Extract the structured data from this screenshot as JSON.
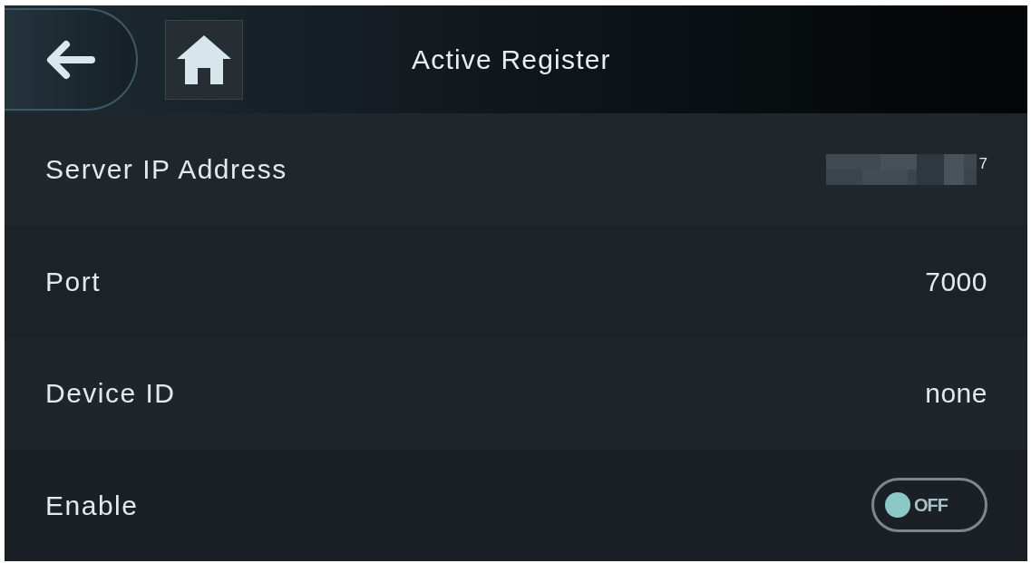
{
  "header": {
    "title": "Active Register"
  },
  "rows": [
    {
      "kind": "text",
      "label": "Server IP Address",
      "value": "7",
      "redacted": true
    },
    {
      "kind": "text",
      "label": "Port",
      "value": "7000",
      "redacted": false
    },
    {
      "kind": "text",
      "label": "Device ID",
      "value": "none",
      "redacted": false
    },
    {
      "kind": "toggle",
      "label": "Enable",
      "on": false,
      "toggle_text": "OFF"
    }
  ]
}
